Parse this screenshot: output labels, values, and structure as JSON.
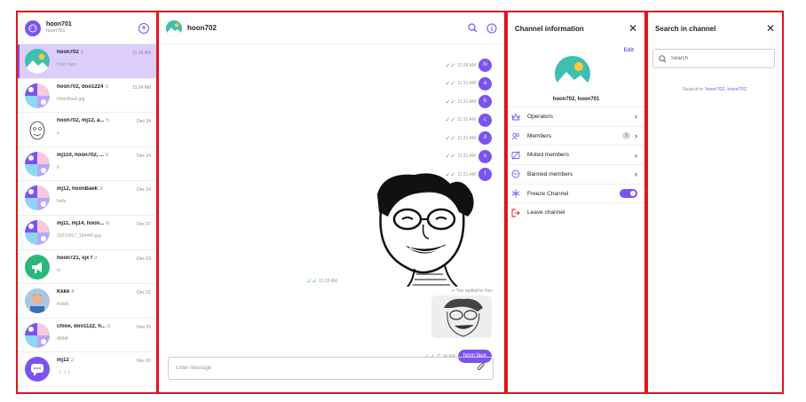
{
  "colors": {
    "accent": "#7b53ef",
    "highlight_border": "#e0141e",
    "check_green": "#2bb77c",
    "active_bg": "#dccdfb"
  },
  "user": {
    "nickname": "hoon701",
    "id": "hoon701"
  },
  "channels": [
    {
      "name": "hoon702",
      "count": "2",
      "date": "11:34 AM",
      "last_message": "hoon face",
      "active": true,
      "avatar": "mountain-icon"
    },
    {
      "name": "hoon702, doo1224",
      "count": "3",
      "date": "11:24 AM",
      "last_message": "HoonBaek.jpg",
      "active": false,
      "avatar": "group-avatar"
    },
    {
      "name": "hoon702, mj12, a...",
      "count": "5",
      "date": "Dec 24",
      "last_message": "a",
      "active": false,
      "avatar": "sketch-avatar"
    },
    {
      "name": "mj110, hoon702, ...",
      "count": "5",
      "date": "Dec 24",
      "last_message": "h",
      "active": false,
      "avatar": "group-avatar"
    },
    {
      "name": "mj12, hoonBaek",
      "count": "3",
      "date": "Dec 24",
      "last_message": "hello",
      "active": false,
      "avatar": "group-avatar"
    },
    {
      "name": "mj11, mj14, hoon...",
      "count": "6",
      "date": "Dec 07",
      "last_message": "20210917_164440.jpg",
      "active": false,
      "avatar": "group-avatar"
    },
    {
      "name": "hoon721, xjx f",
      "count": "3",
      "date": "Dec 03",
      "last_message": "hi",
      "active": false,
      "avatar": "broadcast-icon"
    },
    {
      "name": "Kkkk",
      "count": "4",
      "date": "Dec 01",
      "last_message": "Kkkkk",
      "active": false,
      "avatar": "photo-avatar"
    },
    {
      "name": "chloe, doo1122, h...",
      "count": "5",
      "date": "Nov 20",
      "last_message": "dfdfdf",
      "active": false,
      "avatar": "group-avatar"
    },
    {
      "name": "mj12",
      "count": "2",
      "date": "Nov 20",
      "last_message": ": ) : ) :)",
      "active": false,
      "avatar": "chat-icon"
    }
  ],
  "chat": {
    "title": "hoon702",
    "messages": [
      {
        "time": "11:28 AM",
        "text": "hi"
      },
      {
        "time": "11:31 AM",
        "text": "a"
      },
      {
        "time": "11:31 AM",
        "text": "b"
      },
      {
        "time": "11:31 AM",
        "text": "c"
      },
      {
        "time": "11:31 AM",
        "text": "d"
      },
      {
        "time": "11:31 AM",
        "text": "e"
      },
      {
        "time": "11:31 AM",
        "text": "f"
      }
    ],
    "image_time": "11:33 AM",
    "reply_label": "You replied to You",
    "reply_time": "11:34 AM",
    "reply_text": "hoon face",
    "input_placeholder": "Enter message"
  },
  "info": {
    "title": "Channel information",
    "edit": "Edit",
    "channel_name": "hoon702, hoon701",
    "menu": [
      {
        "label": "Operators",
        "icon": "crown-icon",
        "badge": "",
        "type": "chevron"
      },
      {
        "label": "Members",
        "icon": "members-icon",
        "badge": "2",
        "type": "chevron"
      },
      {
        "label": "Muted members",
        "icon": "mute-icon",
        "badge": "",
        "type": "chevron"
      },
      {
        "label": "Banned members",
        "icon": "ban-icon",
        "badge": "",
        "type": "chevron"
      },
      {
        "label": "Freeze Channel",
        "icon": "snowflake-icon",
        "badge": "",
        "type": "toggle",
        "toggled": true
      },
      {
        "label": "Leave channel",
        "icon": "leave-icon",
        "badge": "",
        "type": "none"
      }
    ]
  },
  "search": {
    "title": "Search in channel",
    "placeholder": "Search",
    "hint_prefix": "Search in ",
    "hint_query": "'hoon702, hoon701'"
  }
}
